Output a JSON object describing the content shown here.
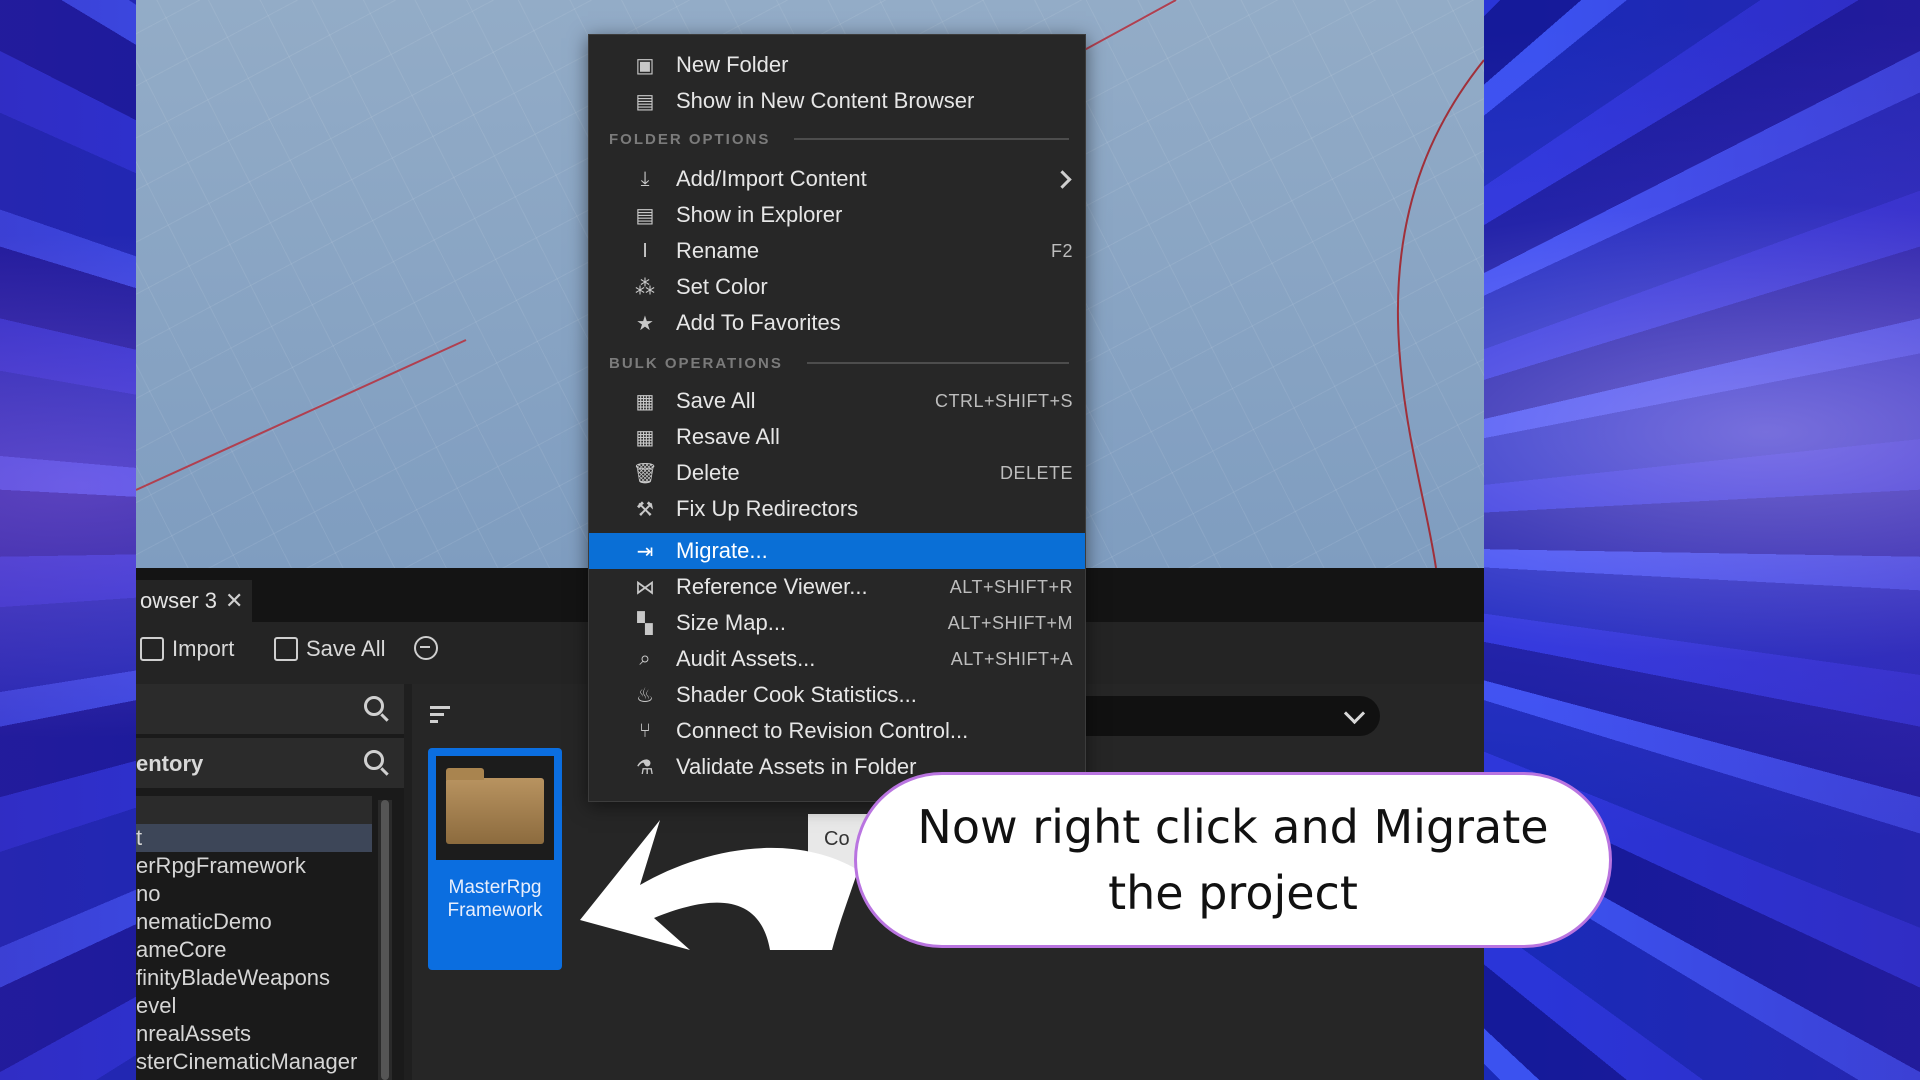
{
  "colors": {
    "highlight": "#0a6fd6",
    "menu_bg": "#272727",
    "bubble_border": "#b974e0",
    "tile_selected": "#0b6ee0"
  },
  "tab": {
    "title": "owser 3",
    "close_icon": "close-icon"
  },
  "toolbar": {
    "import_label": "Import",
    "save_all_label": "Save All"
  },
  "left_panel": {
    "section_label": "entory",
    "tree": [
      "t",
      "erRpgFramework",
      "no",
      "nematicDemo",
      "ameCore",
      "finityBladeWeapons",
      "evel",
      "nrealAssets",
      "sterCinematicManager"
    ]
  },
  "content": {
    "tile_label_line1": "MasterRpg",
    "tile_label_line2": "Framework",
    "stub_text": "Co"
  },
  "menu": {
    "top_items": [
      {
        "label": "New Folder",
        "icon": "new-folder-icon"
      },
      {
        "label": "Show in New Content Browser",
        "icon": "folder-search-icon"
      }
    ],
    "folder_options_header": "FOLDER OPTIONS",
    "folder_items": [
      {
        "label": "Add/Import Content",
        "icon": "import-icon",
        "submenu": true
      },
      {
        "label": "Show in Explorer",
        "icon": "folder-search-icon"
      },
      {
        "label": "Rename",
        "icon": "rename-icon",
        "shortcut": "F2"
      },
      {
        "label": "Set Color",
        "icon": "color-icon"
      },
      {
        "label": "Add To Favorites",
        "icon": "star-icon"
      }
    ],
    "bulk_header": "BULK OPERATIONS",
    "bulk_items": [
      {
        "label": "Save All",
        "icon": "save-icon",
        "shortcut": "CTRL+SHIFT+S"
      },
      {
        "label": "Resave All",
        "icon": "save-icon"
      },
      {
        "label": "Delete",
        "icon": "trash-icon",
        "shortcut": "DELETE"
      },
      {
        "label": "Fix Up Redirectors",
        "icon": "wrench-icon"
      },
      {
        "label": "Migrate...",
        "icon": "migrate-icon",
        "highlighted": true
      },
      {
        "label": "Reference Viewer...",
        "icon": "reference-icon",
        "shortcut": "ALT+SHIFT+R"
      },
      {
        "label": "Size Map...",
        "icon": "size-map-icon",
        "shortcut": "ALT+SHIFT+M"
      },
      {
        "label": "Audit Assets...",
        "icon": "audit-icon",
        "shortcut": "ALT+SHIFT+A"
      },
      {
        "label": "Shader Cook Statistics...",
        "icon": "shader-icon"
      },
      {
        "label": "Connect to Revision Control...",
        "icon": "branch-icon"
      },
      {
        "label": "Validate Assets in Folder",
        "icon": "flask-icon"
      }
    ]
  },
  "callout": {
    "text": "Now right click and Migrate the project"
  }
}
